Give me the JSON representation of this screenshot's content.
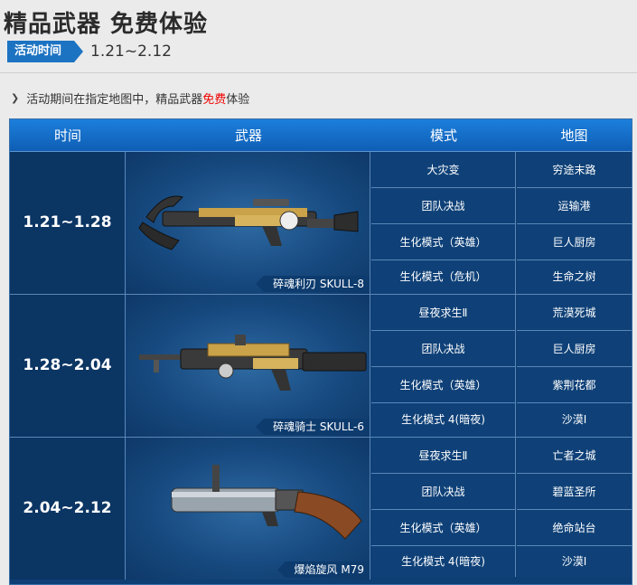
{
  "header": {
    "title": "精品武器 免费体验",
    "tag_label": "活动时间",
    "dates": "1.21~2.12"
  },
  "note": {
    "prefix": "活动期间在指定地图中，精品武器",
    "highlight": "免费",
    "suffix": "体验"
  },
  "table": {
    "headers": [
      "时间",
      "武器",
      "模式",
      "地图"
    ],
    "rows": [
      {
        "time": "1.21~1.28",
        "weapon": "碎魂利刃 SKULL-8",
        "entries": [
          {
            "mode": "大灾变",
            "map": "穷途末路"
          },
          {
            "mode": "团队决战",
            "map": "运输港"
          },
          {
            "mode": "生化模式（英雄）",
            "map": "巨人厨房"
          },
          {
            "mode": "生化模式（危机）",
            "map": "生命之树"
          }
        ]
      },
      {
        "time": "1.28~2.04",
        "weapon": "碎魂骑士 SKULL-6",
        "entries": [
          {
            "mode": "昼夜求生Ⅱ",
            "map": "荒漠死城"
          },
          {
            "mode": "团队决战",
            "map": "巨人厨房"
          },
          {
            "mode": "生化模式（英雄）",
            "map": "紫荆花都"
          },
          {
            "mode": "生化模式 4(暗夜)",
            "map": "沙漠Ⅰ"
          }
        ]
      },
      {
        "time": "2.04~2.12",
        "weapon": "爆焰旋风 M79",
        "entries": [
          {
            "mode": "昼夜求生Ⅱ",
            "map": "亡者之城"
          },
          {
            "mode": "团队决战",
            "map": "碧蓝圣所"
          },
          {
            "mode": "生化模式（英雄）",
            "map": "绝命站台"
          },
          {
            "mode": "生化模式 4(暗夜)",
            "map": "沙漠Ⅰ"
          }
        ]
      }
    ]
  },
  "colors": {
    "accent": "#1c73c2",
    "panel": "#0d3f75",
    "highlight": "#e00000"
  }
}
